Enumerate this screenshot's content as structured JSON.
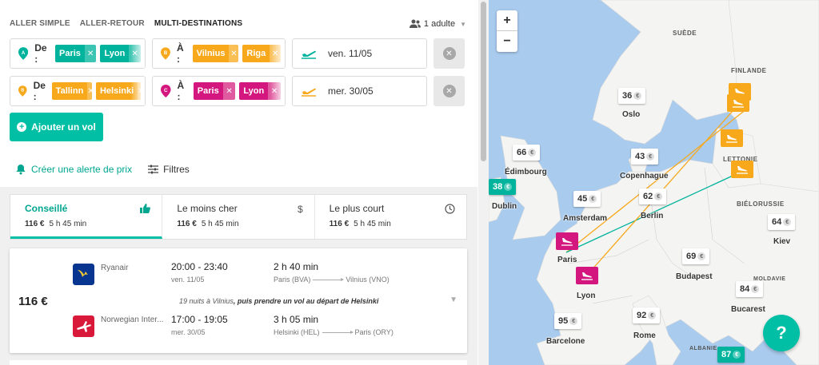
{
  "search": {
    "trip_types": [
      {
        "label": "ALLER SIMPLE",
        "active": false
      },
      {
        "label": "ALLER-RETOUR",
        "active": false
      },
      {
        "label": "MULTI-DESTINATIONS",
        "active": true
      }
    ],
    "passengers": "1 adulte",
    "legs": [
      {
        "from_badge": "A",
        "from_label": "De :",
        "from_chips": [
          "Paris",
          "Lyon"
        ],
        "to_badge": "B",
        "to_label": "À :",
        "to_chips": [
          "Vilnius",
          "Riga"
        ],
        "date": "ven. 11/05"
      },
      {
        "from_badge": "B",
        "from_label": "De :",
        "from_chips": [
          "Tallinn",
          "Helsinki"
        ],
        "to_badge": "C",
        "to_label": "À :",
        "to_chips": [
          "Paris",
          "Lyon"
        ],
        "date": "mer. 30/05"
      }
    ],
    "add_flight_label": "Ajouter un vol",
    "alert_label": "Créer une alerte de prix",
    "filters_label": "Filtres"
  },
  "sort_tabs": [
    {
      "title": "Conseillé",
      "price": "116 €",
      "duration": "5 h 45 min",
      "icon": "thumbs-up-icon",
      "active": true
    },
    {
      "title": "Le moins cher",
      "price": "116 €",
      "duration": "5 h 45 min",
      "icon": "dollar-icon",
      "active": false
    },
    {
      "title": "Le plus court",
      "price": "116 €",
      "duration": "5 h 45 min",
      "icon": "clock-icon",
      "active": false
    }
  ],
  "result": {
    "price": "116 €",
    "outbound": {
      "airline": "Ryanair",
      "time": "20:00 - 23:40",
      "date": "ven. 11/05",
      "duration": "2 h 40 min",
      "from": "Paris (BVA)",
      "to": "Vilnius (VNO)"
    },
    "stopover_prefix": "19 nuits à Vilnius",
    "stopover_suffix": ", puis prendre un vol au départ de Helsinki",
    "inbound": {
      "airline": "Norwegian Inter...",
      "time": "17:00 - 19:05",
      "date": "mer. 30/05",
      "duration": "3 h 05 min",
      "from": "Helsinki (HEL)",
      "to": "Paris (ORY)"
    }
  },
  "map": {
    "countries": [
      "SUÈDE",
      "FINLANDE",
      "LETTONIE",
      "BIÉLORUSSIE",
      "MOLDAVIE",
      "ALBANIE"
    ],
    "cities": [
      "Oslo",
      "Édimbourg",
      "Dublin",
      "Copenhague",
      "Amsterdam",
      "Berlin",
      "Kiev",
      "Paris",
      "Budapest",
      "Lyon",
      "Bucarest",
      "Barcelone",
      "Rome"
    ],
    "prices": [
      "36",
      "66",
      "38",
      "43",
      "45",
      "62",
      "64",
      "69",
      "84",
      "95",
      "92",
      "87"
    ],
    "currency": "€",
    "help_label": "?",
    "colors": {
      "teal": "#00b39c",
      "orange": "#f7a81b",
      "pink": "#d4177e",
      "water": "#a9cbee",
      "land": "#f4f4f2"
    }
  }
}
